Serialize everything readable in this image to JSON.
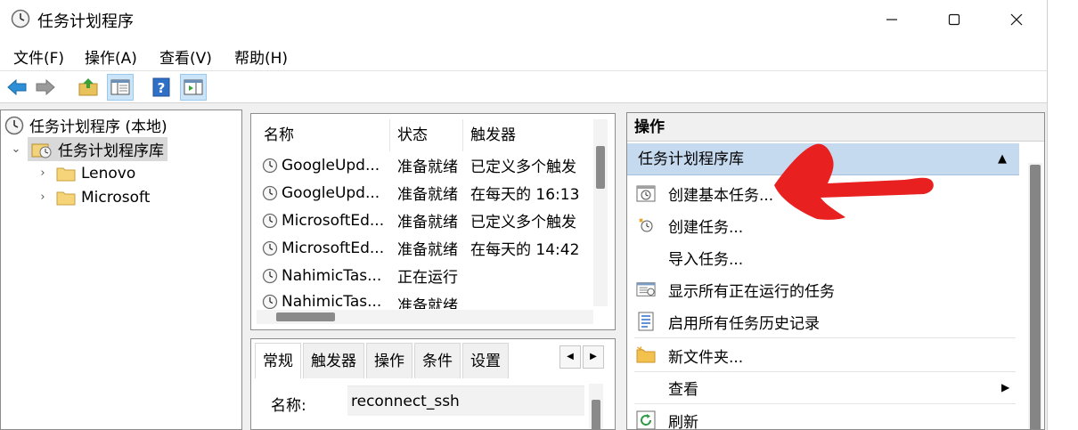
{
  "window": {
    "title": "任务计划程序"
  },
  "menu": [
    "文件(F)",
    "操作(A)",
    "查看(V)",
    "帮助(H)"
  ],
  "toolbar": [
    "back-icon",
    "forward-icon",
    "up-folder-icon",
    "show-hide-tree-icon",
    "help-icon",
    "show-hide-action-pane-icon"
  ],
  "tree": {
    "root": "任务计划程序 (本地)",
    "library": "任务计划程序库",
    "children": [
      "Lenovo",
      "Microsoft"
    ]
  },
  "task_list": {
    "columns": [
      "名称",
      "状态",
      "触发器"
    ],
    "rows": [
      {
        "name": "GoogleUpd...",
        "status": "准备就绪",
        "trigger": "已定义多个触发"
      },
      {
        "name": "GoogleUpd...",
        "status": "准备就绪",
        "trigger": "在每天的 16:13"
      },
      {
        "name": "MicrosoftEd...",
        "status": "准备就绪",
        "trigger": "已定义多个触发"
      },
      {
        "name": "MicrosoftEd...",
        "status": "准备就绪",
        "trigger": "在每天的 14:42"
      },
      {
        "name": "NahimicTas...",
        "status": "正在运行",
        "trigger": ""
      },
      {
        "name": "NahimicTas...",
        "status": "准备就绪",
        "trigger": ""
      }
    ]
  },
  "details": {
    "tabs": [
      "常规",
      "触发器",
      "操作",
      "条件",
      "设置"
    ],
    "name_label": "名称:",
    "name_value": "reconnect_ssh"
  },
  "actions": {
    "title": "操作",
    "section": "任务计划程序库",
    "items": [
      {
        "label": "创建基本任务...",
        "icon": "create-basic-task-icon"
      },
      {
        "label": "创建任务...",
        "icon": "create-task-icon"
      },
      {
        "label": "导入任务...",
        "icon": ""
      },
      {
        "label": "显示所有正在运行的任务",
        "icon": "running-tasks-icon"
      },
      {
        "label": "启用所有任务历史记录",
        "icon": "history-icon"
      },
      {
        "label": "新文件夹...",
        "icon": "new-folder-icon"
      },
      {
        "label": "查看",
        "icon": ""
      },
      {
        "label": "刷新",
        "icon": "refresh-icon"
      }
    ]
  },
  "colors": {
    "selection": "#d9d9d9",
    "section_header": "#c5d9ef",
    "annotation_arrow": "#e8201f"
  }
}
